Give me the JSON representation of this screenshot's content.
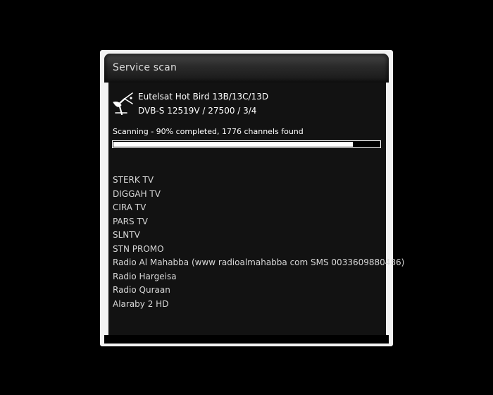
{
  "dialog": {
    "title": "Service scan"
  },
  "satellite": {
    "icon": "satellite-dish-icon",
    "name": "Eutelsat Hot Bird 13B/13C/13D",
    "transponder": "DVB-S 12519V / 27500 / 3/4"
  },
  "scan": {
    "status": "Scanning - 90% completed, 1776 channels found",
    "progress_percent": 90
  },
  "channels": [
    "STERK TV",
    "DIGGAH TV",
    "CIRA TV",
    "PARS TV",
    "SLNTV",
    "STN PROMO",
    "Radio Al Mahabba (www radioalmahabba com SMS 0033609880486)",
    "Radio Hargeisa",
    "Radio Quraan",
    "Alaraby 2 HD"
  ],
  "colors": {
    "background": "#000000",
    "frame": "#f2f2f2",
    "panel": "#121212",
    "text": "#ffffff"
  }
}
